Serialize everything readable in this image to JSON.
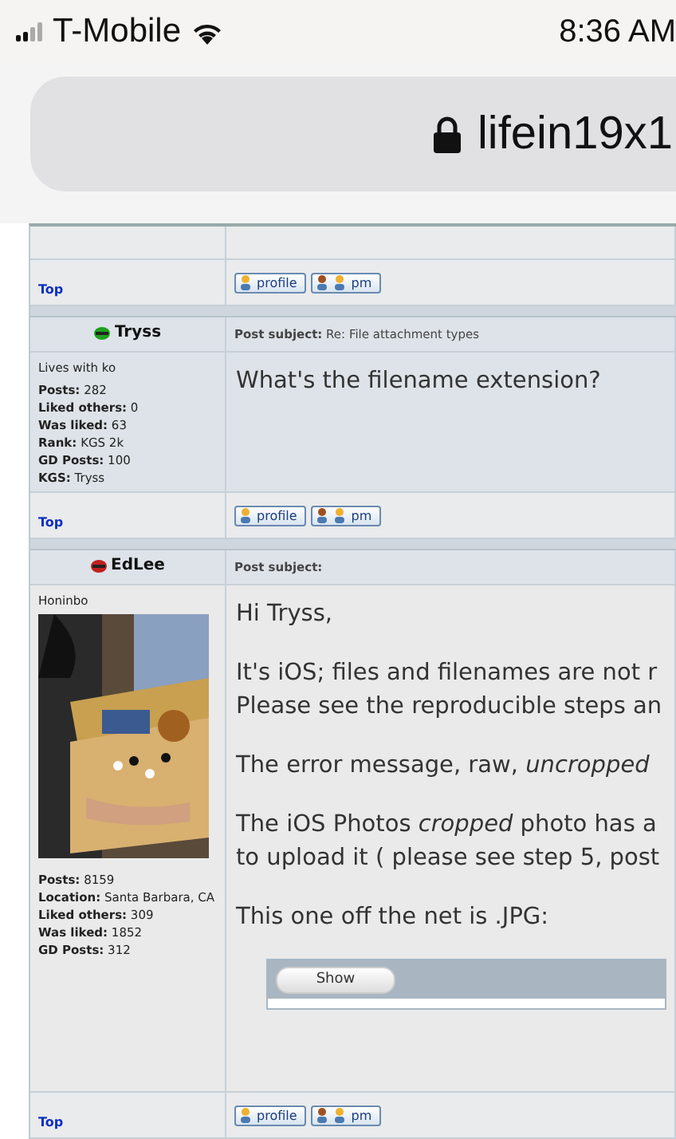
{
  "status_bar": {
    "carrier": "T-Mobile",
    "time": "8:36 AM"
  },
  "address_bar": {
    "url": "lifein19x1"
  },
  "posts": [
    {
      "kind": "footer_only",
      "footer": {
        "top_link": "Top",
        "buttons": [
          "profile",
          "pm"
        ]
      }
    },
    {
      "kind": "post",
      "author": {
        "name": "Tryss",
        "online": true,
        "title": "Lives with ko",
        "stats": [
          {
            "label": "Posts:",
            "value": "282"
          },
          {
            "label": "Liked others:",
            "value": "0"
          },
          {
            "label": "Was liked:",
            "value": "63"
          },
          {
            "label": "Rank:",
            "value": "KGS 2k"
          },
          {
            "label": "GD Posts:",
            "value": "100"
          },
          {
            "label": "KGS:",
            "value": "Tryss"
          }
        ]
      },
      "subject_label": "Post subject:",
      "subject": "Re: File attachment types",
      "body": [
        [
          "What's the filename extension?"
        ]
      ],
      "footer": {
        "top_link": "Top",
        "buttons": [
          "profile",
          "pm"
        ]
      }
    },
    {
      "kind": "post",
      "author": {
        "name": "EdLee",
        "online": false,
        "title": "Honinbo",
        "stats": [
          {
            "label": "Posts:",
            "value": "8159"
          },
          {
            "label": "Location:",
            "value": "Santa Barbara, CA"
          },
          {
            "label": "Liked others:",
            "value": "309"
          },
          {
            "label": "Was liked:",
            "value": "1852"
          },
          {
            "label": "GD Posts:",
            "value": "312"
          }
        ]
      },
      "subject_label": "Post subject:",
      "body": [
        [
          "Hi Tryss,"
        ],
        [
          "It's iOS; files and filenames are not r",
          "Please see the reproducible steps an"
        ],
        [
          "The error message, raw, *uncropped*"
        ],
        [
          "The iOS Photos *cropped* photo has a",
          "to upload it ( please see step 5, post"
        ],
        [
          "This one off the net is .JPG:"
        ]
      ],
      "spoiler": {
        "button": "Show"
      },
      "footer": {
        "top_link": "Top",
        "buttons": [
          "profile",
          "pm"
        ]
      }
    }
  ]
}
